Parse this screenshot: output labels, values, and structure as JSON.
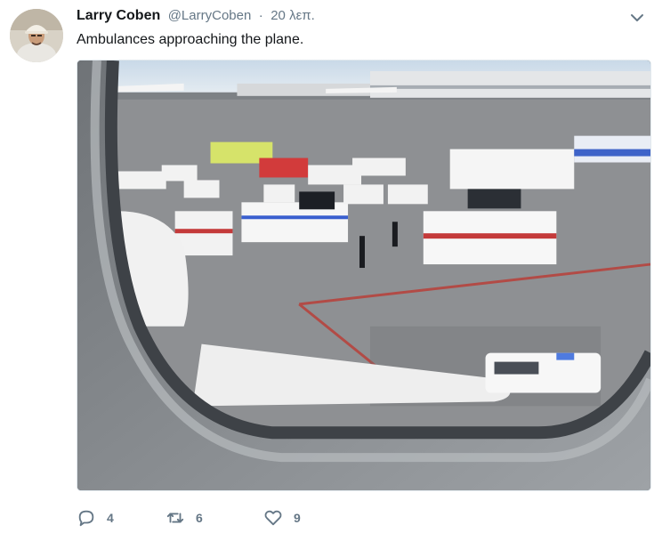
{
  "user": {
    "name": "Larry Coben",
    "handle": "@LarryCoben",
    "separator": "·",
    "time": "20 λεπ."
  },
  "tweet": {
    "text": "Ambulances approaching the plane."
  },
  "media": {
    "description_icon": "photo"
  },
  "actions": {
    "replies": "4",
    "retweets": "6",
    "likes": "9"
  },
  "icons": {
    "caret": "chevron-down-icon",
    "reply": "reply-icon",
    "retweet": "retweet-icon",
    "like": "heart-icon"
  },
  "colors": {
    "text_primary": "#14171a",
    "text_secondary": "#657786"
  }
}
